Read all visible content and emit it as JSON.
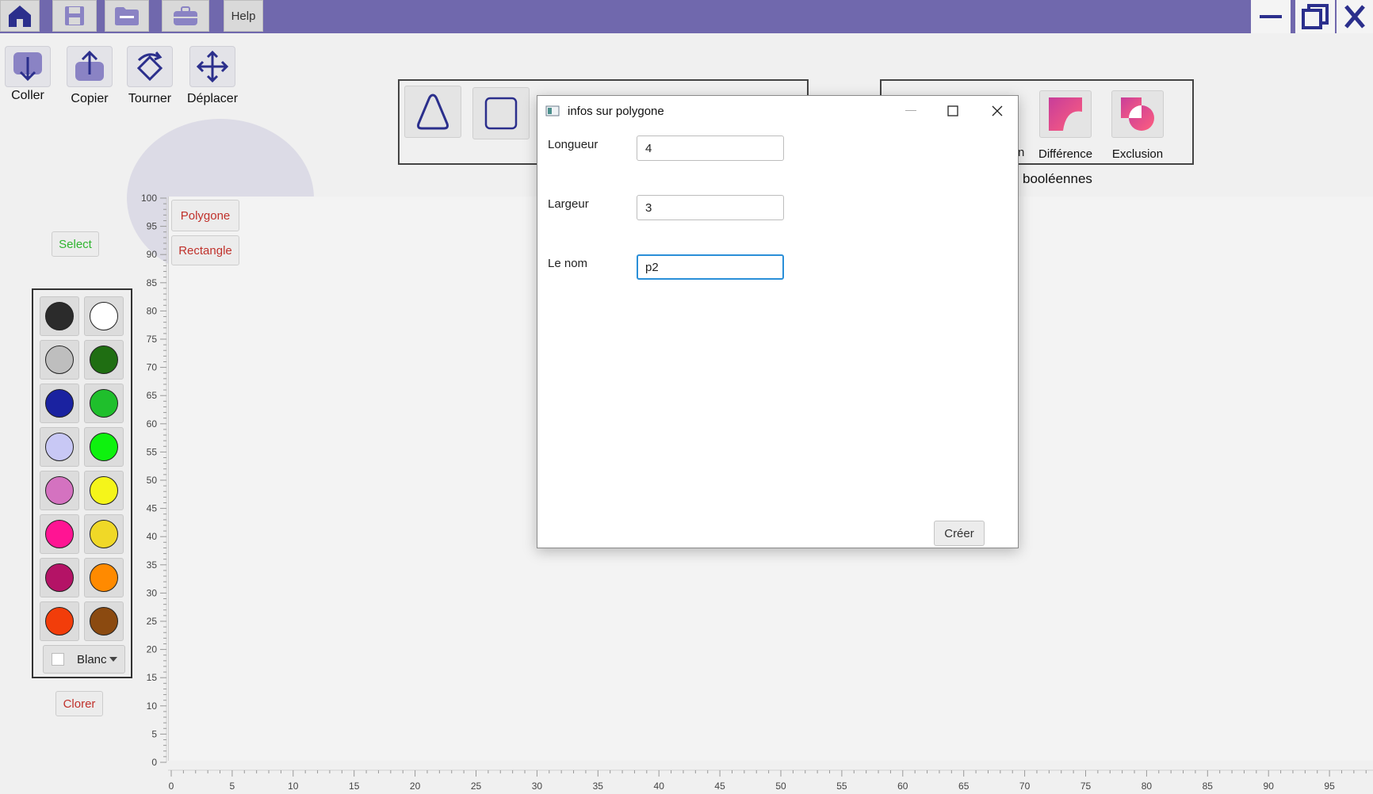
{
  "toolbar": {
    "icons": [
      "home-icon",
      "save-icon",
      "folder-icon",
      "briefcase-icon"
    ],
    "help_label": "Help"
  },
  "window_controls": [
    "minimize-icon",
    "restore-icon",
    "close-icon"
  ],
  "edit_tools": [
    {
      "label": "Coller",
      "icon": "paste-icon"
    },
    {
      "label": "Copier",
      "icon": "copy-icon"
    },
    {
      "label": "Tourner",
      "icon": "rotate-icon"
    },
    {
      "label": "Déplacer",
      "icon": "move-icon"
    }
  ],
  "shapes": [
    "triangle-icon",
    "square-icon"
  ],
  "boolean_ops": {
    "partial_label": "n",
    "items": [
      {
        "label": "Différence",
        "icon": "difference-icon"
      },
      {
        "label": "Exclusion",
        "icon": "exclusion-icon"
      }
    ],
    "group_label": "booléennes"
  },
  "left_panel": {
    "select_label": "Select",
    "colorer_label": "Clorer",
    "color_select_value": "Blanc"
  },
  "palette": {
    "colors": [
      [
        "#2b2b2b",
        "#ffffff"
      ],
      [
        "#bebebe",
        "#1f6e12"
      ],
      [
        "#1a22a0",
        "#1fbf2c"
      ],
      [
        "#c8c8f5",
        "#0ef20e"
      ],
      [
        "#d472c0",
        "#f5f51a"
      ],
      [
        "#ff1493",
        "#f0d827"
      ],
      [
        "#b41366",
        "#ff8a00"
      ],
      [
        "#f23d0a",
        "#8b4a10"
      ]
    ]
  },
  "shape_list": {
    "polygone_label": "Polygone",
    "rectangle_label": "Rectangle"
  },
  "y_axis": {
    "ticks": [
      100,
      95,
      90,
      85,
      80,
      75,
      70,
      65,
      60,
      55,
      50,
      45,
      40,
      35,
      30,
      25,
      20,
      15,
      10,
      5,
      0
    ]
  },
  "x_axis": {
    "ticks": [
      0,
      5,
      10,
      15,
      20,
      25,
      30,
      35,
      40,
      45,
      50,
      55,
      60,
      65,
      70,
      75,
      80,
      85,
      90,
      95
    ]
  },
  "dialog": {
    "title": "infos sur polygone",
    "fields": [
      {
        "label": "Longueur",
        "value": "4"
      },
      {
        "label": "Largeur",
        "value": "3"
      },
      {
        "label": "Le nom",
        "value": "p2"
      }
    ],
    "create_label": "Créer"
  }
}
